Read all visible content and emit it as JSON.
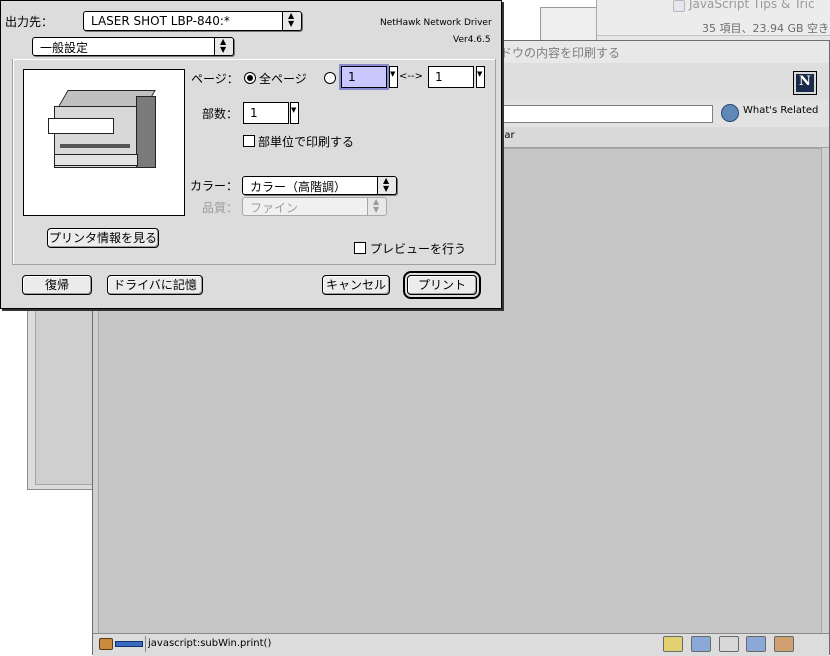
{
  "background": {
    "finder_title": "JavaScript Tips & Tric",
    "disk_info": "35 項目、23.94 GB 空き",
    "browser_title": "ドウの内容を印刷する",
    "related_label": "What's Related",
    "personal_bar_label": "dar",
    "status_text": "javascript:subWin.print()"
  },
  "dialog": {
    "printer_label": "出力先：",
    "printer_value": "LASER SHOT LBP-840:*",
    "driver_name": "NetHawk Network Driver",
    "driver_version": "Ver4.6.5",
    "panel_value": "一般設定",
    "pages_label": "ページ：",
    "all_pages_label": "全ページ",
    "from_value": "1",
    "range_sep": "<-->",
    "to_value": "1",
    "copies_label": "部数：",
    "copies_value": "1",
    "collate_label": "部単位で印刷する",
    "color_label": "カラー：",
    "color_value": "カラー（高階調）",
    "quality_label": "品質：",
    "quality_value": "ファイン",
    "printer_info_button": "プリンタ情報を見る",
    "preview_label": "プレビューを行う",
    "restore_button": "復帰",
    "save_driver_button": "ドライバに記憶",
    "cancel_button": "キャンセル",
    "print_button": "プリント"
  }
}
